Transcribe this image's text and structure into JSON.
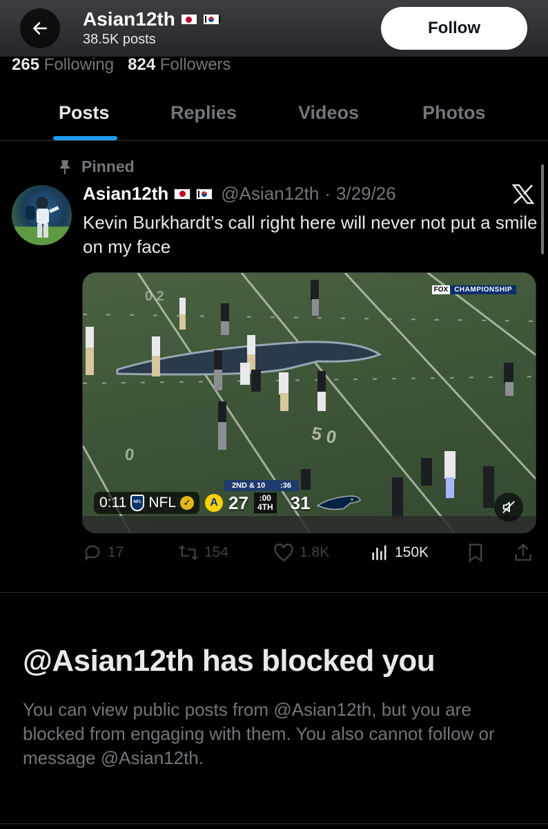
{
  "header": {
    "display_name": "Asian12th",
    "posts_count": "38.5K posts",
    "follow_label": "Follow",
    "back_icon": "arrow-left-icon"
  },
  "stats": {
    "following_count": "265",
    "following_label": "Following",
    "followers_count": "824",
    "followers_label": "Followers"
  },
  "tabs": [
    {
      "label": "Posts",
      "active": true
    },
    {
      "label": "Replies",
      "active": false
    },
    {
      "label": "Videos",
      "active": false
    },
    {
      "label": "Photos",
      "active": false
    }
  ],
  "post": {
    "pinned_label": "Pinned",
    "author_name": "Asian12th",
    "handle": "@Asian12th",
    "separator": "·",
    "date": "3/29/26",
    "text": "Kevin Burkhardt’s call right here will never not put a smile on my face",
    "video": {
      "duration": "0:11",
      "channel": "NFL",
      "network_badge_fox": "FOX",
      "network_badge_text": "CHAMPIONSHIP",
      "down_distance": "2ND & 10",
      "play_clock": ":36",
      "away_score": "27",
      "home_score": "31",
      "game_clock": ":00",
      "quarter": "4TH"
    },
    "actions": {
      "replies": "17",
      "reposts": "154",
      "likes": "1.8K",
      "views": "150K"
    }
  },
  "blocked": {
    "title": "@Asian12th has blocked you",
    "body": "You can view public posts from @Asian12th, but you are blocked from engaging with them. You also cannot follow or message @Asian12th."
  },
  "colors": {
    "accent": "#1d9bf0",
    "muted_text": "#71767b",
    "primary_text": "#e7e9ea",
    "background": "#000000"
  }
}
